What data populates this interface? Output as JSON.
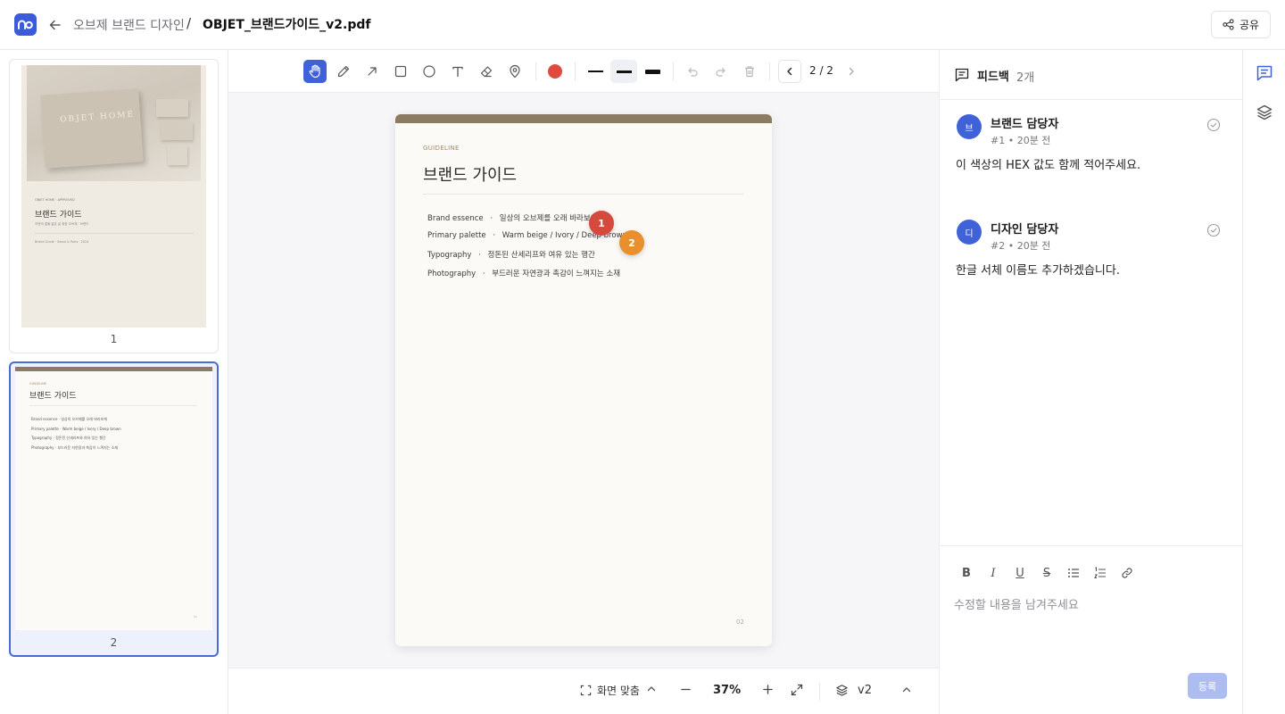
{
  "header": {
    "project": "오브제 브랜드 디자인",
    "separator": "/",
    "file_name": "OBJET_브랜드가이드_v2.pdf",
    "share_label": "공유"
  },
  "thumbnails": [
    {
      "label": "1",
      "cover_text": "OBJET HOME",
      "meta": "OBJET HOME · APPROVED",
      "title": "브랜드 가이드",
      "subtitle": "자연의 결을 닮은 삶 위한 오브제 · 브랜드",
      "footer": "Brand Guide · Seoul & Paris · 2024",
      "active": false
    },
    {
      "label": "2",
      "kicker": "GUIDELINE",
      "title": "브랜드 가이드",
      "active": true
    }
  ],
  "toolbar": {
    "tools": [
      "hand-icon",
      "pencil-icon",
      "arrow-icon",
      "rectangle-icon",
      "circle-icon",
      "text-icon",
      "eraser-icon",
      "pin-icon"
    ],
    "active_tool": "hand-icon",
    "color": "#e04a3f",
    "page_indicator": "2 / 2"
  },
  "document": {
    "kicker": "GUIDELINE",
    "title": "브랜드 가이드",
    "rows": [
      {
        "label": "Brand essence",
        "sep": "·",
        "value": "일상의 오브제를 오래 바라보게"
      },
      {
        "label": "Primary palette",
        "sep": "·",
        "value": "Warm beige / Ivory / Deep brown"
      },
      {
        "label": "Typography",
        "sep": "·",
        "value": "정돈된 산세리프와 여유 있는 행간"
      },
      {
        "label": "Photography",
        "sep": "·",
        "value": "부드러운 자연광과 촉감이 느껴지는 소재"
      }
    ],
    "page_no": "02",
    "pins": [
      {
        "number": "1",
        "color": "#d64a3e"
      },
      {
        "number": "2",
        "color": "#e98f2e"
      }
    ]
  },
  "bottombar": {
    "fit_label": "화면 맞춤",
    "zoom": "37%",
    "version": "v2"
  },
  "feedback": {
    "title": "피드백",
    "count": "2개",
    "comments": [
      {
        "avatar": "브",
        "author": "브랜드 담당자",
        "meta": "#1 • 20분 전",
        "text": "이 색상의 HEX 값도 함께 적어주세요."
      },
      {
        "avatar": "디",
        "author": "디자인 담당자",
        "meta": "#2 • 20분 전",
        "text": "한글 서체 이름도 추가하겠습니다."
      }
    ],
    "composer_placeholder": "수정할 내용을 남겨주세요",
    "submit_label": "등록"
  }
}
